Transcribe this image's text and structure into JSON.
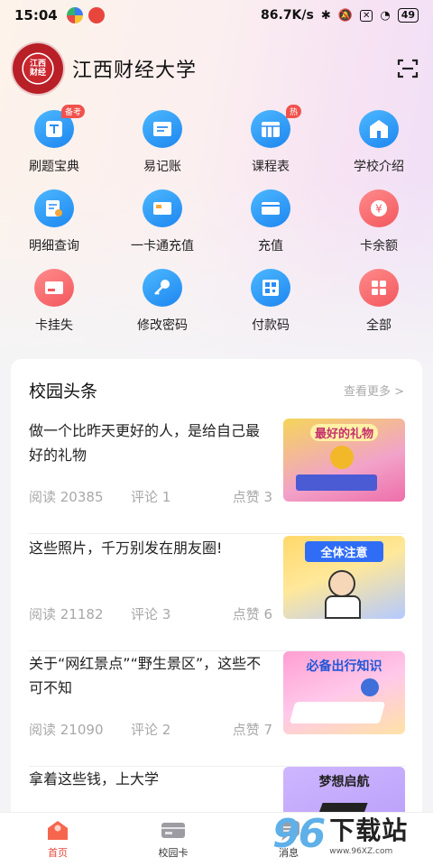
{
  "status": {
    "time": "15:04",
    "net_speed": "86.7K/s",
    "battery": "49"
  },
  "header": {
    "title": "江西财经大学",
    "logo_label": "江西财经大学"
  },
  "grid": {
    "items": [
      {
        "label": "刷题宝典",
        "icon": "question-book-icon",
        "color": "blue",
        "badge": "备考"
      },
      {
        "label": "易记账",
        "icon": "ledger-icon",
        "color": "blue",
        "badge": ""
      },
      {
        "label": "课程表",
        "icon": "timetable-icon",
        "color": "blue",
        "badge": "热"
      },
      {
        "label": "学校介绍",
        "icon": "school-building-icon",
        "color": "blue",
        "badge": ""
      },
      {
        "label": "明细查询",
        "icon": "detail-search-icon",
        "color": "blue",
        "badge": ""
      },
      {
        "label": "一卡通充值",
        "icon": "card-recharge-icon",
        "color": "blue",
        "badge": ""
      },
      {
        "label": "充值",
        "icon": "recharge-card-icon",
        "color": "blue",
        "badge": ""
      },
      {
        "label": "卡余额",
        "icon": "balance-yen-icon",
        "color": "red",
        "badge": ""
      },
      {
        "label": "卡挂失",
        "icon": "card-lost-icon",
        "color": "red",
        "badge": ""
      },
      {
        "label": "修改密码",
        "icon": "key-icon",
        "color": "blue",
        "badge": ""
      },
      {
        "label": "付款码",
        "icon": "qr-code-icon",
        "color": "blue",
        "badge": ""
      },
      {
        "label": "全部",
        "icon": "all-apps-icon",
        "color": "red",
        "badge": ""
      }
    ]
  },
  "news": {
    "section_title": "校园头条",
    "more_label": "查看更多 >",
    "items": [
      {
        "title": "做一个比昨天更好的人，是给自己最好的礼物",
        "views": "阅读 20385",
        "comments": "评论 1",
        "likes": "点赞 3",
        "thumb_text": "最好的礼物"
      },
      {
        "title": "这些照片，千万别发在朋友圈!",
        "views": "阅读 21182",
        "comments": "评论 3",
        "likes": "点赞 6",
        "thumb_text": "全体注意"
      },
      {
        "title": "关于“网红景点”“野生景区”，这些不可不知",
        "views": "阅读 21090",
        "comments": "评论 2",
        "likes": "点赞 7",
        "thumb_text": "必备出行知识"
      },
      {
        "title": "拿着这些钱，上大学",
        "views": "",
        "comments": "",
        "likes": "",
        "thumb_text": "梦想启航"
      }
    ]
  },
  "tabs": [
    {
      "label": "首页",
      "icon": "home-icon",
      "active": true
    },
    {
      "label": "校园卡",
      "icon": "campus-card-icon",
      "active": false
    },
    {
      "label": "消息",
      "icon": "message-icon",
      "active": false
    }
  ],
  "watermark": {
    "number": "96",
    "text": "下载站",
    "url": "www.96XZ.com"
  }
}
